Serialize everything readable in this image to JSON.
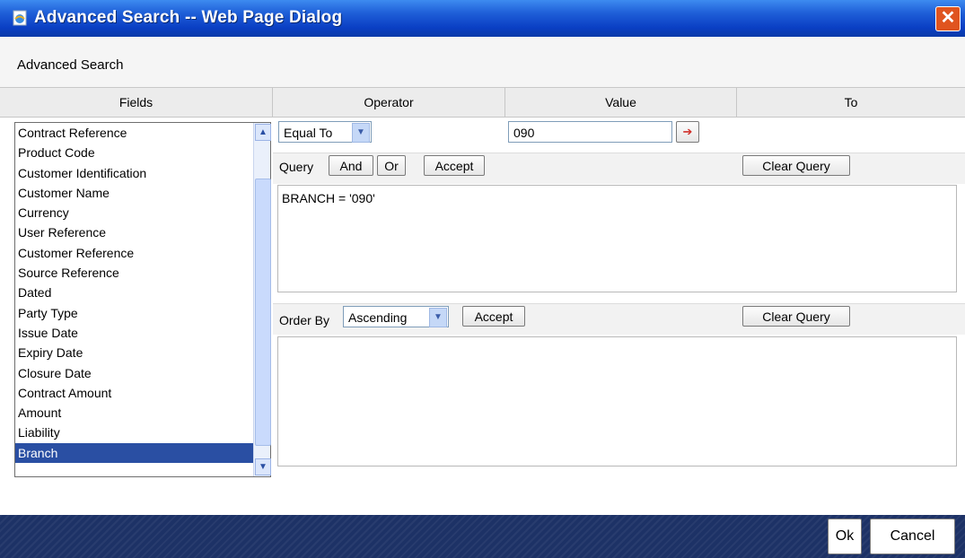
{
  "window": {
    "title": "Advanced Search -- Web Page Dialog",
    "close_symbol": "✕"
  },
  "dialog": {
    "heading": "Advanced Search"
  },
  "columns": {
    "fields": "Fields",
    "operator": "Operator",
    "value": "Value",
    "to": "To"
  },
  "fields": [
    "Contract Reference",
    "Product Code",
    "Customer Identification",
    "Customer Name",
    "Currency",
    "User Reference",
    "Customer Reference",
    "Source Reference",
    "Dated",
    "Party Type",
    "Issue Date",
    "Expiry Date",
    "Closure Date",
    "Contract Amount",
    "Amount",
    "Liability",
    "Branch"
  ],
  "selected_field": "Branch",
  "operator": {
    "selected": "Equal To"
  },
  "value": {
    "text": "090"
  },
  "query": {
    "label": "Query",
    "and": "And",
    "or": "Or",
    "accept": "Accept",
    "clear": "Clear Query",
    "text": "BRANCH = '090'"
  },
  "order": {
    "label": "Order By",
    "selected": "Ascending",
    "accept": "Accept",
    "clear": "Clear Query",
    "text": ""
  },
  "footer": {
    "ok": "Ok",
    "cancel": "Cancel"
  },
  "icons": {
    "app": "ie-page-icon",
    "close": "close-icon",
    "dropdown": "chevron-down-icon",
    "lookup": "list-lookup-icon"
  },
  "colors": {
    "titlebar": "#0a3fc4",
    "selection": "#2a4fa3",
    "footer": "#1d3266",
    "close": "#e0541f"
  }
}
